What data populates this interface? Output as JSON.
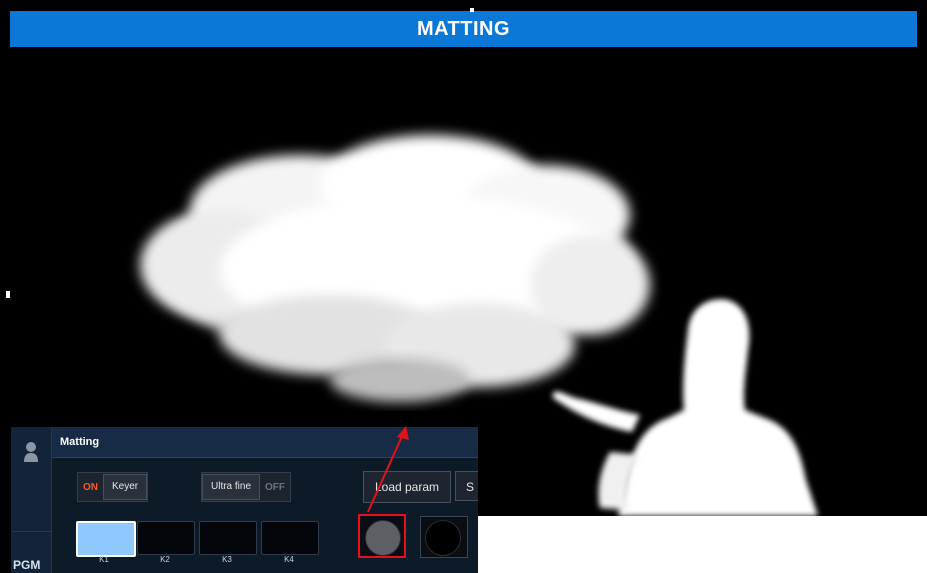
{
  "header": {
    "title": "MATTING"
  },
  "panel": {
    "title": "Matting",
    "sidebar_label": "PGM",
    "keyer": {
      "state_label": "ON",
      "button_label": "Keyer"
    },
    "ultra_fine": {
      "button_label": "Ultra fine",
      "state_label": "OFF"
    },
    "load_param_label": "Load param",
    "save_param_label": "S",
    "keys": [
      {
        "label": "K1",
        "active": true
      },
      {
        "label": "K2",
        "active": false
      },
      {
        "label": "K3",
        "active": false
      },
      {
        "label": "K4",
        "active": false
      }
    ],
    "key_color_swatch": "#5c5f64",
    "fill_color_swatch": "#000000"
  },
  "colors": {
    "header_bar": "#0b78d8",
    "annotation_red": "#e3121a",
    "on_orange": "#ff5a1f",
    "active_key": "#8ec8ff"
  }
}
